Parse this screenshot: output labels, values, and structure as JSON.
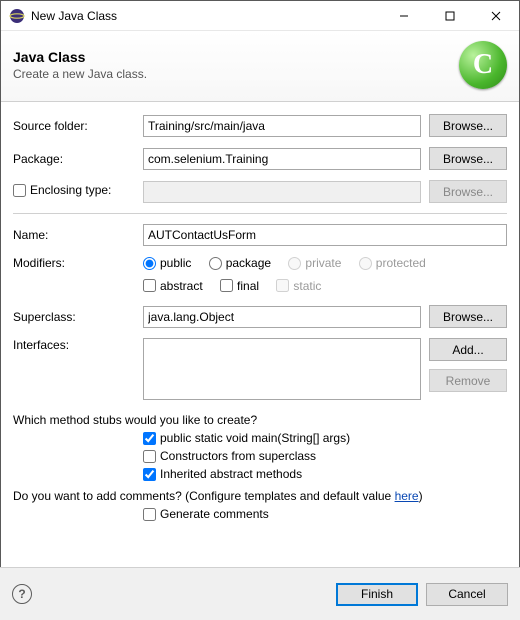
{
  "window": {
    "title": "New Java Class"
  },
  "banner": {
    "heading": "Java Class",
    "subtitle": "Create a new Java class.",
    "icon_letter": "C"
  },
  "fields": {
    "source_folder": {
      "label": "Source folder:",
      "value": "Training/src/main/java",
      "browse": "Browse..."
    },
    "package": {
      "label": "Package:",
      "value": "com.selenium.Training",
      "browse": "Browse..."
    },
    "enclosing": {
      "label": "Enclosing type:",
      "value": "",
      "browse": "Browse..."
    },
    "name": {
      "label": "Name:",
      "value": "AUTContactUsForm"
    },
    "modifiers": {
      "label": "Modifiers:",
      "visibility": {
        "public": "public",
        "package": "package",
        "private": "private",
        "protected": "protected"
      },
      "abstract": "abstract",
      "final": "final",
      "static": "static"
    },
    "superclass": {
      "label": "Superclass:",
      "value": "java.lang.Object",
      "browse": "Browse..."
    },
    "interfaces": {
      "label": "Interfaces:",
      "add": "Add...",
      "remove": "Remove"
    }
  },
  "stubs": {
    "question": "Which method stubs would you like to create?",
    "main": "public static void main(String[] args)",
    "constructors": "Constructors from superclass",
    "inherited": "Inherited abstract methods"
  },
  "comments": {
    "question_prefix": "Do you want to add comments? (Configure templates and default value ",
    "link": "here",
    "question_suffix": ")",
    "generate": "Generate comments"
  },
  "buttons": {
    "finish": "Finish",
    "cancel": "Cancel"
  }
}
